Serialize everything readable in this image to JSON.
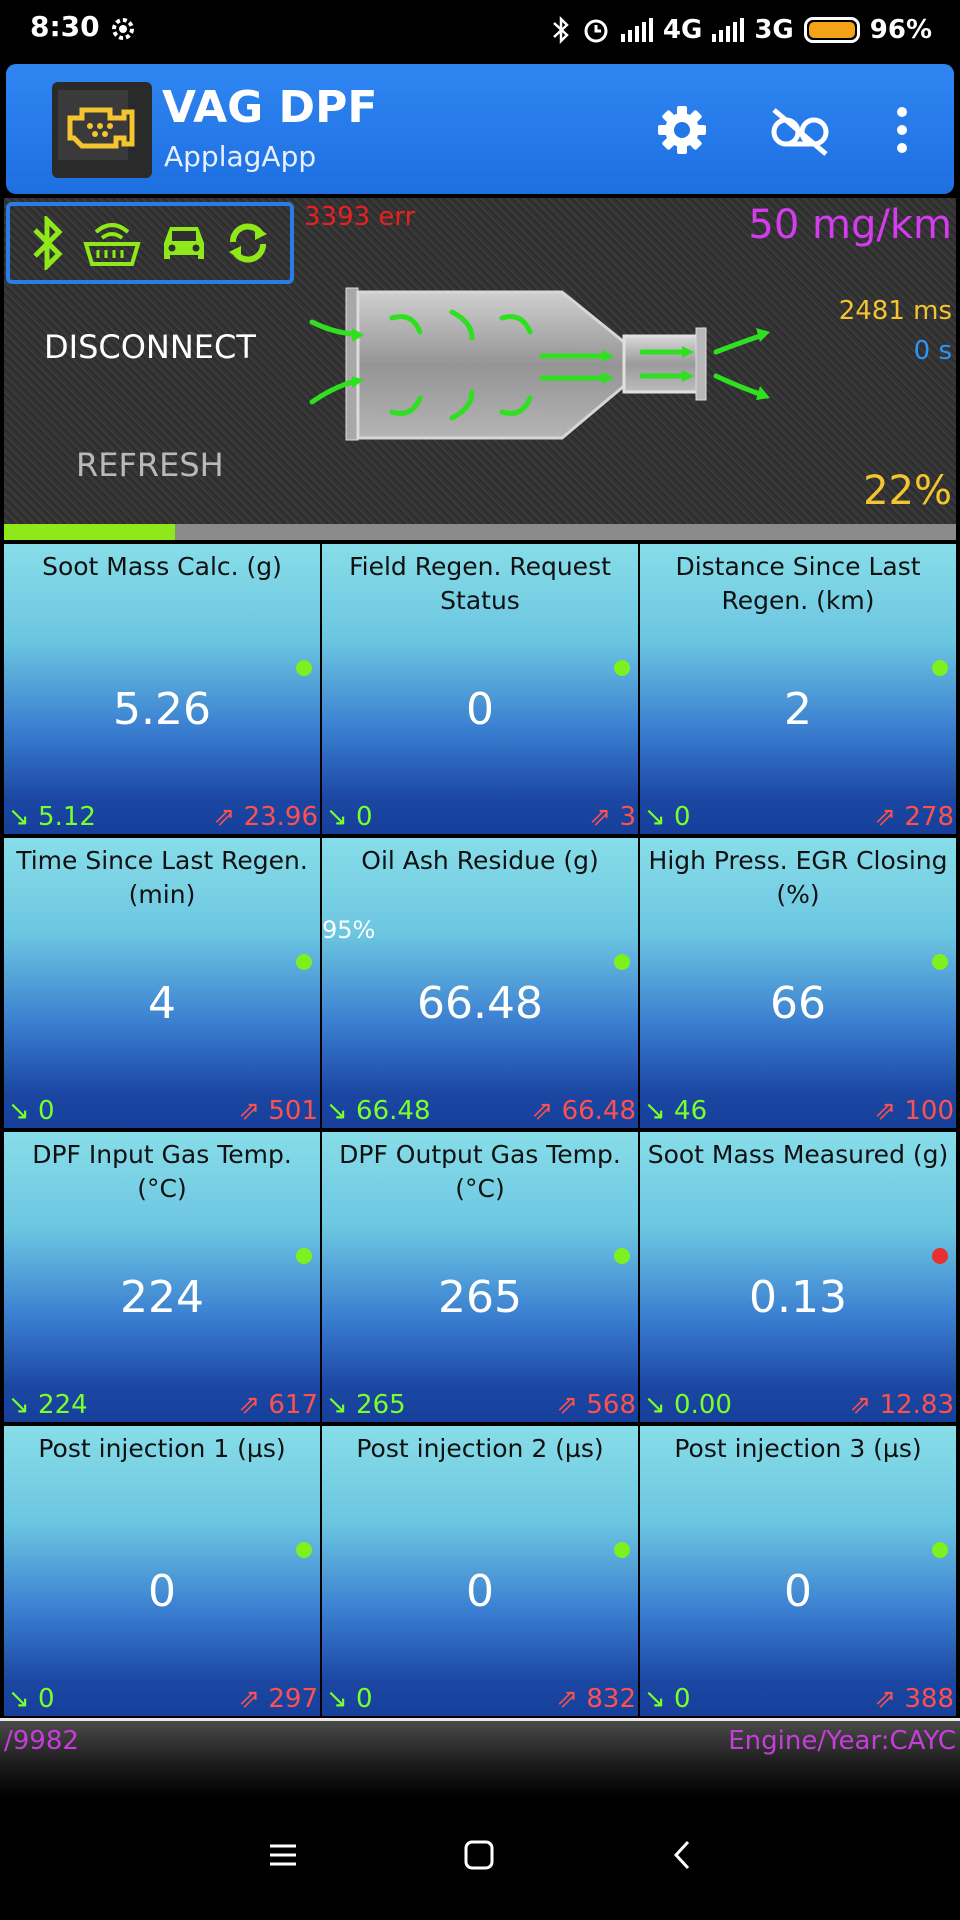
{
  "status_bar": {
    "time": "8:30",
    "net1": "4G",
    "net2": "3G",
    "battery": "96%"
  },
  "app": {
    "title": "VAG DPF",
    "subtitle": "ApplagApp"
  },
  "header": {
    "error": "3393 err",
    "emission": "50 mg/km",
    "response_ms": "2481 ms",
    "seconds": "0 s",
    "percent": "22%",
    "disconnect_label": "DISCONNECT",
    "refresh_label": "REFRESH",
    "progress": 0.18
  },
  "tiles": [
    {
      "title": "Soot Mass Calc. (g)",
      "value": "5.26",
      "min": "↘ 5.12",
      "max": "⇗ 23.96",
      "dot": "#7ef020"
    },
    {
      "title": "Field Regen. Request Status",
      "value": "0",
      "min": "↘ 0",
      "max": "⇗ 3",
      "dot": "#7ef020"
    },
    {
      "title": "Distance Since Last Regen. (km)",
      "value": "2",
      "min": "↘ 0",
      "max": "⇗ 278",
      "dot": "#7ef020"
    },
    {
      "title": "Time Since Last Regen. (min)",
      "value": "4",
      "min": "↘ 0",
      "max": "⇗ 501",
      "dot": "#7ef020"
    },
    {
      "title": "Oil Ash Residue (g)",
      "value": "66.48",
      "min": "↘ 66.48",
      "max": "⇗ 66.48",
      "dot": "#7ef020",
      "extra": "95%"
    },
    {
      "title": "High Press. EGR Closing (%)",
      "value": "66",
      "min": "↘ 46",
      "max": "⇗ 100",
      "dot": "#7ef020"
    },
    {
      "title": "DPF Input Gas Temp. (°C)",
      "value": "224",
      "min": "↘ 224",
      "max": "⇗ 617",
      "dot": "#7ef020"
    },
    {
      "title": "DPF Output Gas Temp. (°C)",
      "value": "265",
      "min": "↘ 265",
      "max": "⇗ 568",
      "dot": "#7ef020"
    },
    {
      "title": "Soot Mass Measured (g)",
      "value": "0.13",
      "min": "↘ 0.00",
      "max": "⇗ 12.83",
      "dot": "#e83030"
    },
    {
      "title": "Post injection 1 (µs)",
      "value": "0",
      "min": "↘ 0",
      "max": "⇗ 297",
      "dot": "#7ef020"
    },
    {
      "title": "Post injection 2 (µs)",
      "value": "0",
      "min": "↘ 0",
      "max": "⇗ 832",
      "dot": "#7ef020"
    },
    {
      "title": "Post injection 3 (µs)",
      "value": "0",
      "min": "↘ 0",
      "max": "⇗ 388",
      "dot": "#7ef020"
    }
  ],
  "footer": {
    "left": "/9982",
    "right": "Engine/Year:CAYC"
  },
  "icons": {
    "connection": [
      "bluetooth-icon",
      "obd-adapter-icon",
      "car-icon",
      "sync-icon"
    ],
    "toolbar": [
      "settings-gear-icon",
      "record-off-icon",
      "more-vert-icon"
    ],
    "nav": [
      "menu-icon",
      "home-icon",
      "back-icon"
    ]
  }
}
